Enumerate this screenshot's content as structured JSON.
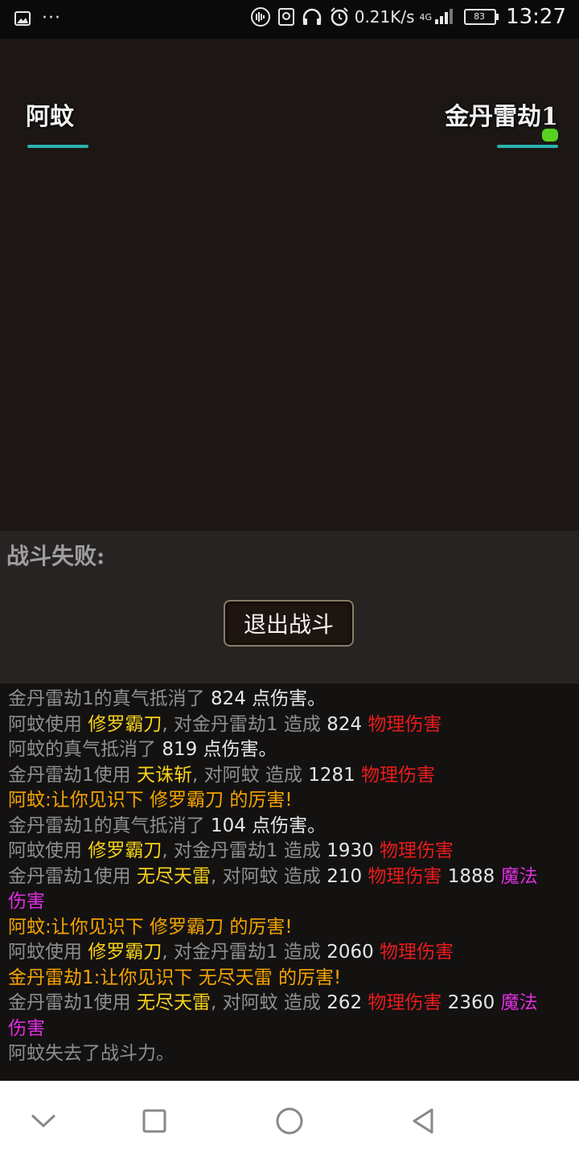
{
  "status_bar": {
    "net_speed": "0.21K/s",
    "network_type": "4G",
    "battery": "83",
    "time": "13:27",
    "icons": [
      "image-icon",
      "more-icon",
      "vibrate-icon",
      "nfc-icon",
      "headset-icon",
      "alarm-icon",
      "signal-icon",
      "battery-icon"
    ]
  },
  "battle": {
    "left_name": "阿蚊",
    "right_name": "金丹雷劫1",
    "hp_color": "#2ab3b0",
    "status_color": "#57d11f"
  },
  "result": {
    "label": "战斗失败:",
    "exit_button": "退出战斗"
  },
  "log": [
    [
      {
        "t": "金丹雷劫1的真气抵消了 ",
        "c": "gray"
      },
      {
        "t": "824",
        "c": "white"
      },
      {
        "t": " 点伤害。",
        "c": "white"
      }
    ],
    [
      {
        "t": "阿蚊使用 ",
        "c": "gray"
      },
      {
        "t": "修罗霸刀",
        "c": "yellow"
      },
      {
        "t": ", 对金丹雷劫1 造成 ",
        "c": "gray"
      },
      {
        "t": "824",
        "c": "white"
      },
      {
        "t": " 物理伤害",
        "c": "red"
      }
    ],
    [
      {
        "t": "阿蚊的真气抵消了 ",
        "c": "gray"
      },
      {
        "t": "819",
        "c": "white"
      },
      {
        "t": " 点伤害。",
        "c": "white"
      }
    ],
    [
      {
        "t": "金丹雷劫1使用 ",
        "c": "gray"
      },
      {
        "t": "天诛斩",
        "c": "yellow"
      },
      {
        "t": ", 对阿蚊 造成 ",
        "c": "gray"
      },
      {
        "t": "1281",
        "c": "white"
      },
      {
        "t": " 物理伤害",
        "c": "red"
      }
    ],
    [
      {
        "t": "阿蚊:让你见识下 修罗霸刀 的厉害!",
        "c": "orange"
      }
    ],
    [
      {
        "t": "金丹雷劫1的真气抵消了 ",
        "c": "gray"
      },
      {
        "t": "104",
        "c": "white"
      },
      {
        "t": " 点伤害。",
        "c": "white"
      }
    ],
    [
      {
        "t": "阿蚊使用 ",
        "c": "gray"
      },
      {
        "t": "修罗霸刀",
        "c": "yellow"
      },
      {
        "t": ", 对金丹雷劫1 造成 ",
        "c": "gray"
      },
      {
        "t": "1930",
        "c": "white"
      },
      {
        "t": " 物理伤害",
        "c": "red"
      }
    ],
    [
      {
        "t": "金丹雷劫1使用 ",
        "c": "gray"
      },
      {
        "t": "无尽天雷",
        "c": "yellow"
      },
      {
        "t": ", 对阿蚊 造成 ",
        "c": "gray"
      },
      {
        "t": "210",
        "c": "white"
      },
      {
        "t": " 物理伤害",
        "c": "red"
      },
      {
        "t": " 1888",
        "c": "white"
      },
      {
        "t": " 魔法伤害",
        "c": "magenta"
      }
    ],
    [
      {
        "t": "阿蚊:让你见识下 修罗霸刀 的厉害!",
        "c": "orange"
      }
    ],
    [
      {
        "t": "阿蚊使用 ",
        "c": "gray"
      },
      {
        "t": "修罗霸刀",
        "c": "yellow"
      },
      {
        "t": ", 对金丹雷劫1 造成 ",
        "c": "gray"
      },
      {
        "t": "2060",
        "c": "white"
      },
      {
        "t": " 物理伤害",
        "c": "red"
      }
    ],
    [
      {
        "t": "金丹雷劫1:让你见识下 无尽天雷 的厉害!",
        "c": "orange"
      }
    ],
    [
      {
        "t": "金丹雷劫1使用 ",
        "c": "gray"
      },
      {
        "t": "无尽天雷",
        "c": "yellow"
      },
      {
        "t": ", 对阿蚊 造成 ",
        "c": "gray"
      },
      {
        "t": "262",
        "c": "white"
      },
      {
        "t": " 物理伤害",
        "c": "red"
      },
      {
        "t": " 2360",
        "c": "white"
      },
      {
        "t": " 魔法伤害",
        "c": "magenta"
      }
    ],
    [
      {
        "t": "阿蚊失去了战斗力。",
        "c": "gray"
      }
    ]
  ],
  "nav": {
    "icons": [
      "back-chevron-icon",
      "recents-square-icon",
      "home-circle-icon",
      "back-triangle-icon"
    ]
  }
}
